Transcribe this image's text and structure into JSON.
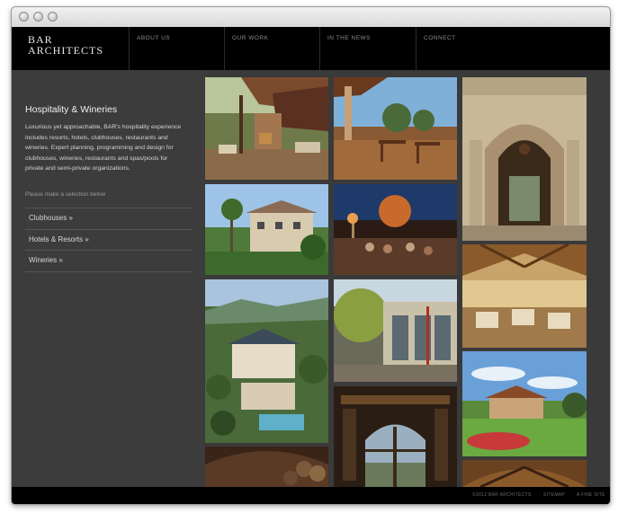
{
  "header": {
    "logo_line1": "BAR",
    "logo_line2": "ARCHITECTS",
    "nav": [
      {
        "label": "ABOUT US"
      },
      {
        "label": "OUR WORK"
      },
      {
        "label": "IN THE NEWS"
      },
      {
        "label": "CONNECT"
      }
    ]
  },
  "sidebar": {
    "title": "Hospitality & Wineries",
    "description": "Luxurious yet approachable, BAR's hospitality experience includes resorts, hotels, clubhouses, restaurants and wineries. Expert planning, programming and design for clubhouses, wineries, restaurants and spas/pools for private and semi-private organizations.",
    "prompt": "Please make a selection below",
    "items": [
      {
        "label": "Clubhouses »"
      },
      {
        "label": "Hotels & Resorts »"
      },
      {
        "label": "Wineries »"
      }
    ]
  },
  "footer": {
    "copyright": "©2012 BAR ARCHITECTS",
    "sep1": "·",
    "sitemap": "SITEMAP",
    "sep2": "·",
    "credit": "A FINE SITE"
  },
  "colors": {
    "page_background": "#111111",
    "sidebar_background": "#3c3c3c",
    "header_background": "#000000"
  }
}
